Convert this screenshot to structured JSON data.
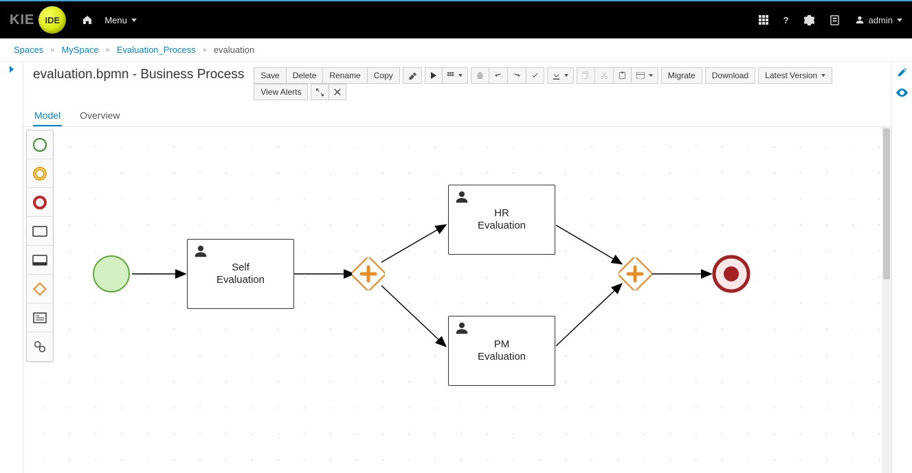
{
  "brand": {
    "kie": "KIE",
    "ide": "IDE"
  },
  "nav": {
    "menu_label": "Menu",
    "user_label": "admin"
  },
  "breadcrumb": {
    "items": [
      "Spaces",
      "MySpace",
      "Evaluation_Process"
    ],
    "current": "evaluation"
  },
  "file": {
    "title": "evaluation.bpmn - Business Process"
  },
  "toolbar": {
    "save": "Save",
    "delete": "Delete",
    "rename": "Rename",
    "copy": "Copy",
    "migrate": "Migrate",
    "download": "Download",
    "latest_version": "Latest Version",
    "view_alerts": "View Alerts"
  },
  "tabs": {
    "model": "Model",
    "overview": "Overview"
  },
  "palette_icons": [
    "start-event",
    "intermediate-event",
    "end-event",
    "task",
    "subprocess",
    "gateway",
    "data-object",
    "settings"
  ],
  "diagram": {
    "tasks": {
      "self": "Self\nEvaluation",
      "hr": "HR\nEvaluation",
      "pm": "PM\nEvaluation"
    }
  }
}
